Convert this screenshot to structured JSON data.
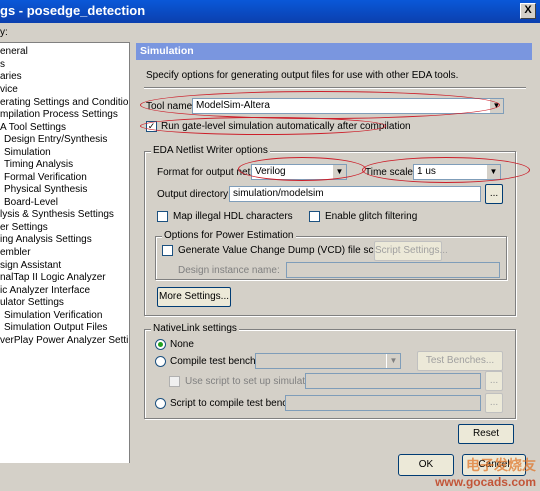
{
  "window": {
    "title": "gs - posedge_detection",
    "close_glyph": "X"
  },
  "category_label": "y:",
  "tree": [
    "eneral",
    "s",
    "aries",
    "vice",
    "erating Settings and Conditions",
    "mpilation Process Settings",
    "A Tool Settings",
    "Design Entry/Synthesis",
    "Simulation",
    "Timing Analysis",
    "Formal Verification",
    "Physical Synthesis",
    "Board-Level",
    "lysis & Synthesis Settings",
    "er Settings",
    "ing Analysis Settings",
    "embler",
    "sign Assistant",
    "nalTap II Logic Analyzer",
    "ic Analyzer Interface",
    "ulator Settings",
    "Simulation Verification",
    "Simulation Output Files",
    "verPlay Power Analyzer Settings"
  ],
  "panel": {
    "header": "Simulation",
    "description": "Specify options for generating output files for use with other EDA tools.",
    "tool_name_label": "Tool name:",
    "tool_name_value": "ModelSim-Altera",
    "run_gate_level_label": "Run gate-level simulation automatically after compilation",
    "run_gate_level_checked": true,
    "eda_netlist_group": "EDA Netlist Writer options",
    "format_label": "Format for output netlist:",
    "format_value": "Verilog",
    "time_scale_label": "Time scale:",
    "time_scale_value": "1 us",
    "output_dir_label": "Output directory:",
    "output_dir_value": "simulation/modelsim",
    "browse_label": "...",
    "map_illegal_label": "Map illegal HDL characters",
    "glitch_label": "Enable glitch filtering",
    "power_group": "Options for Power Estimation",
    "vcd_label": "Generate Value Change Dump (VCD) file script",
    "script_settings_label": "Script Settings...",
    "design_instance_label": "Design instance name:",
    "more_settings_label": "More Settings...",
    "nativelink_group": "NativeLink settings",
    "none_label": "None",
    "compile_tb_label": "Compile test bench:",
    "test_benches_label": "Test Benches...",
    "use_script_label": "Use script to set up simulation:",
    "script_compile_label": "Script to compile test bench:",
    "reset_label": "Reset"
  },
  "buttons": {
    "ok": "OK",
    "cancel": "Cancel"
  },
  "watermark": {
    "line1": "电子发烧友",
    "line2": "www.gocads.com"
  },
  "colors": {
    "annotation": "#cc1f2a",
    "header": "#7a96df",
    "titlebar": "#0b4fc6"
  }
}
